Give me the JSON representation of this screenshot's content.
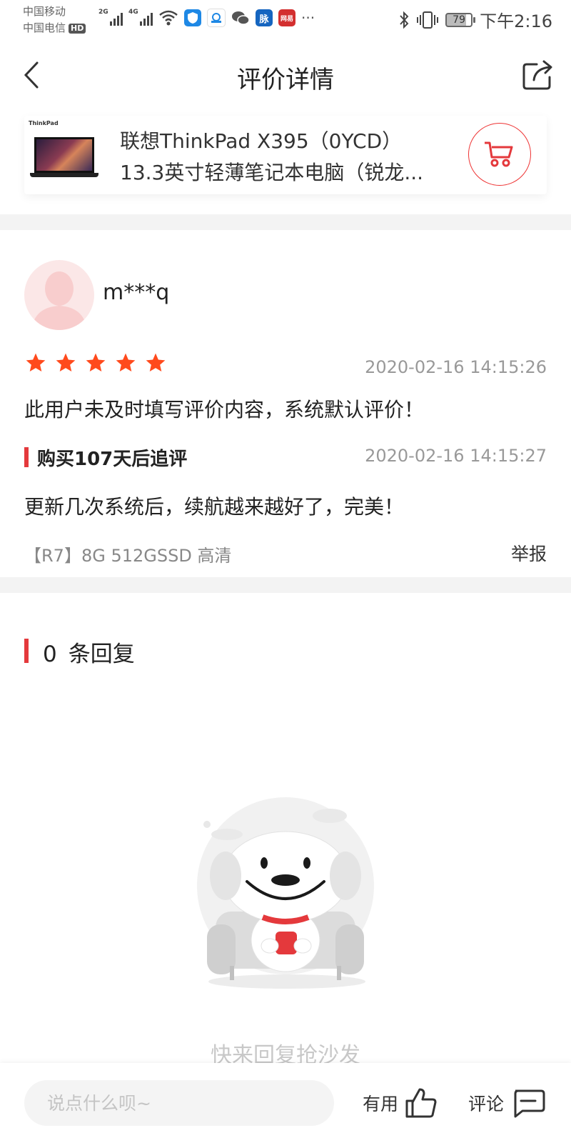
{
  "status_bar": {
    "carrier1": "中国移动",
    "carrier2": "中国电信",
    "hd_badge": "HD",
    "net1": "2G",
    "net2": "4G",
    "app_badge_mai": "脉",
    "app_badge_wangyi": "网易",
    "more": "···",
    "battery": "79",
    "time": "下午2:16"
  },
  "header": {
    "title": "评价详情"
  },
  "product": {
    "brand_mark": "ThinkPad",
    "title_line1": "联想ThinkPad X395（0YCD）",
    "title_line2": "13.3英寸轻薄笔记本电脑（锐龙..."
  },
  "review": {
    "username": "m***q",
    "rating": 5,
    "date": "2020-02-16 14:15:26",
    "content": "此用户未及时填写评价内容，系统默认评价！",
    "followup_title": "购买107天后追评",
    "followup_date": "2020-02-16 14:15:27",
    "followup_content": "更新几次系统后，续航越来越好了，完美！",
    "spec": "【R7】8G 512GSSD 高清",
    "report_label": "举报"
  },
  "replies": {
    "count": "0",
    "label": "条回复",
    "empty_text": "快来回复抢沙发"
  },
  "bottom_bar": {
    "input_placeholder": "说点什么呗~",
    "useful_label": "有用",
    "comment_label": "评论"
  },
  "colors": {
    "accent": "#e4393c",
    "star": "#ff4a1c"
  }
}
